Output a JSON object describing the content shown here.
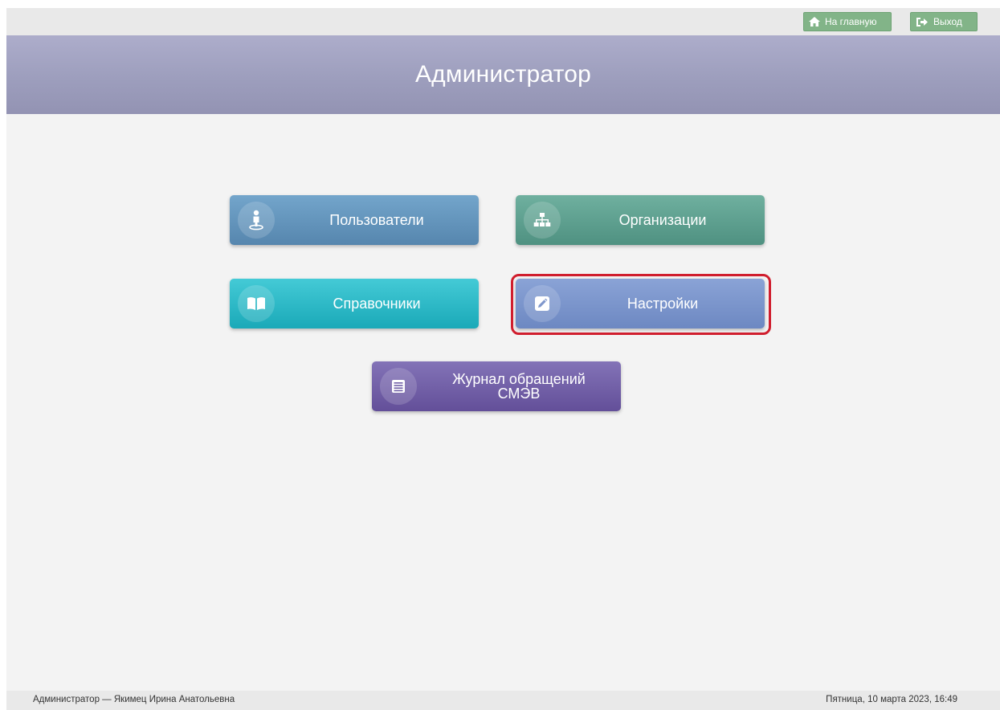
{
  "topbar": {
    "home_label": "На главную",
    "exit_label": "Выход",
    "home_icon": "home-icon",
    "exit_icon": "sign-out-icon"
  },
  "header": {
    "title": "Администратор"
  },
  "tiles": [
    {
      "label": "Пользователи",
      "icon": "user-icon"
    },
    {
      "label": "Организации",
      "icon": "sitemap-icon"
    },
    {
      "label": "Справочники",
      "icon": "book-icon"
    },
    {
      "label": "Настройки",
      "icon": "edit-icon"
    },
    {
      "label_line1": "Журнал обращений",
      "label_line2": "СМЭВ",
      "icon": "list-icon"
    }
  ],
  "footer": {
    "user": "Администратор — Якимец Ирина Анатольевна",
    "datetime": "Пятница, 10 марта 2023, 16:49"
  },
  "colors": {
    "accent_highlight": "#d01e2e",
    "header_bg": "#9d9ebd",
    "top_button_bg": "#82b488"
  }
}
